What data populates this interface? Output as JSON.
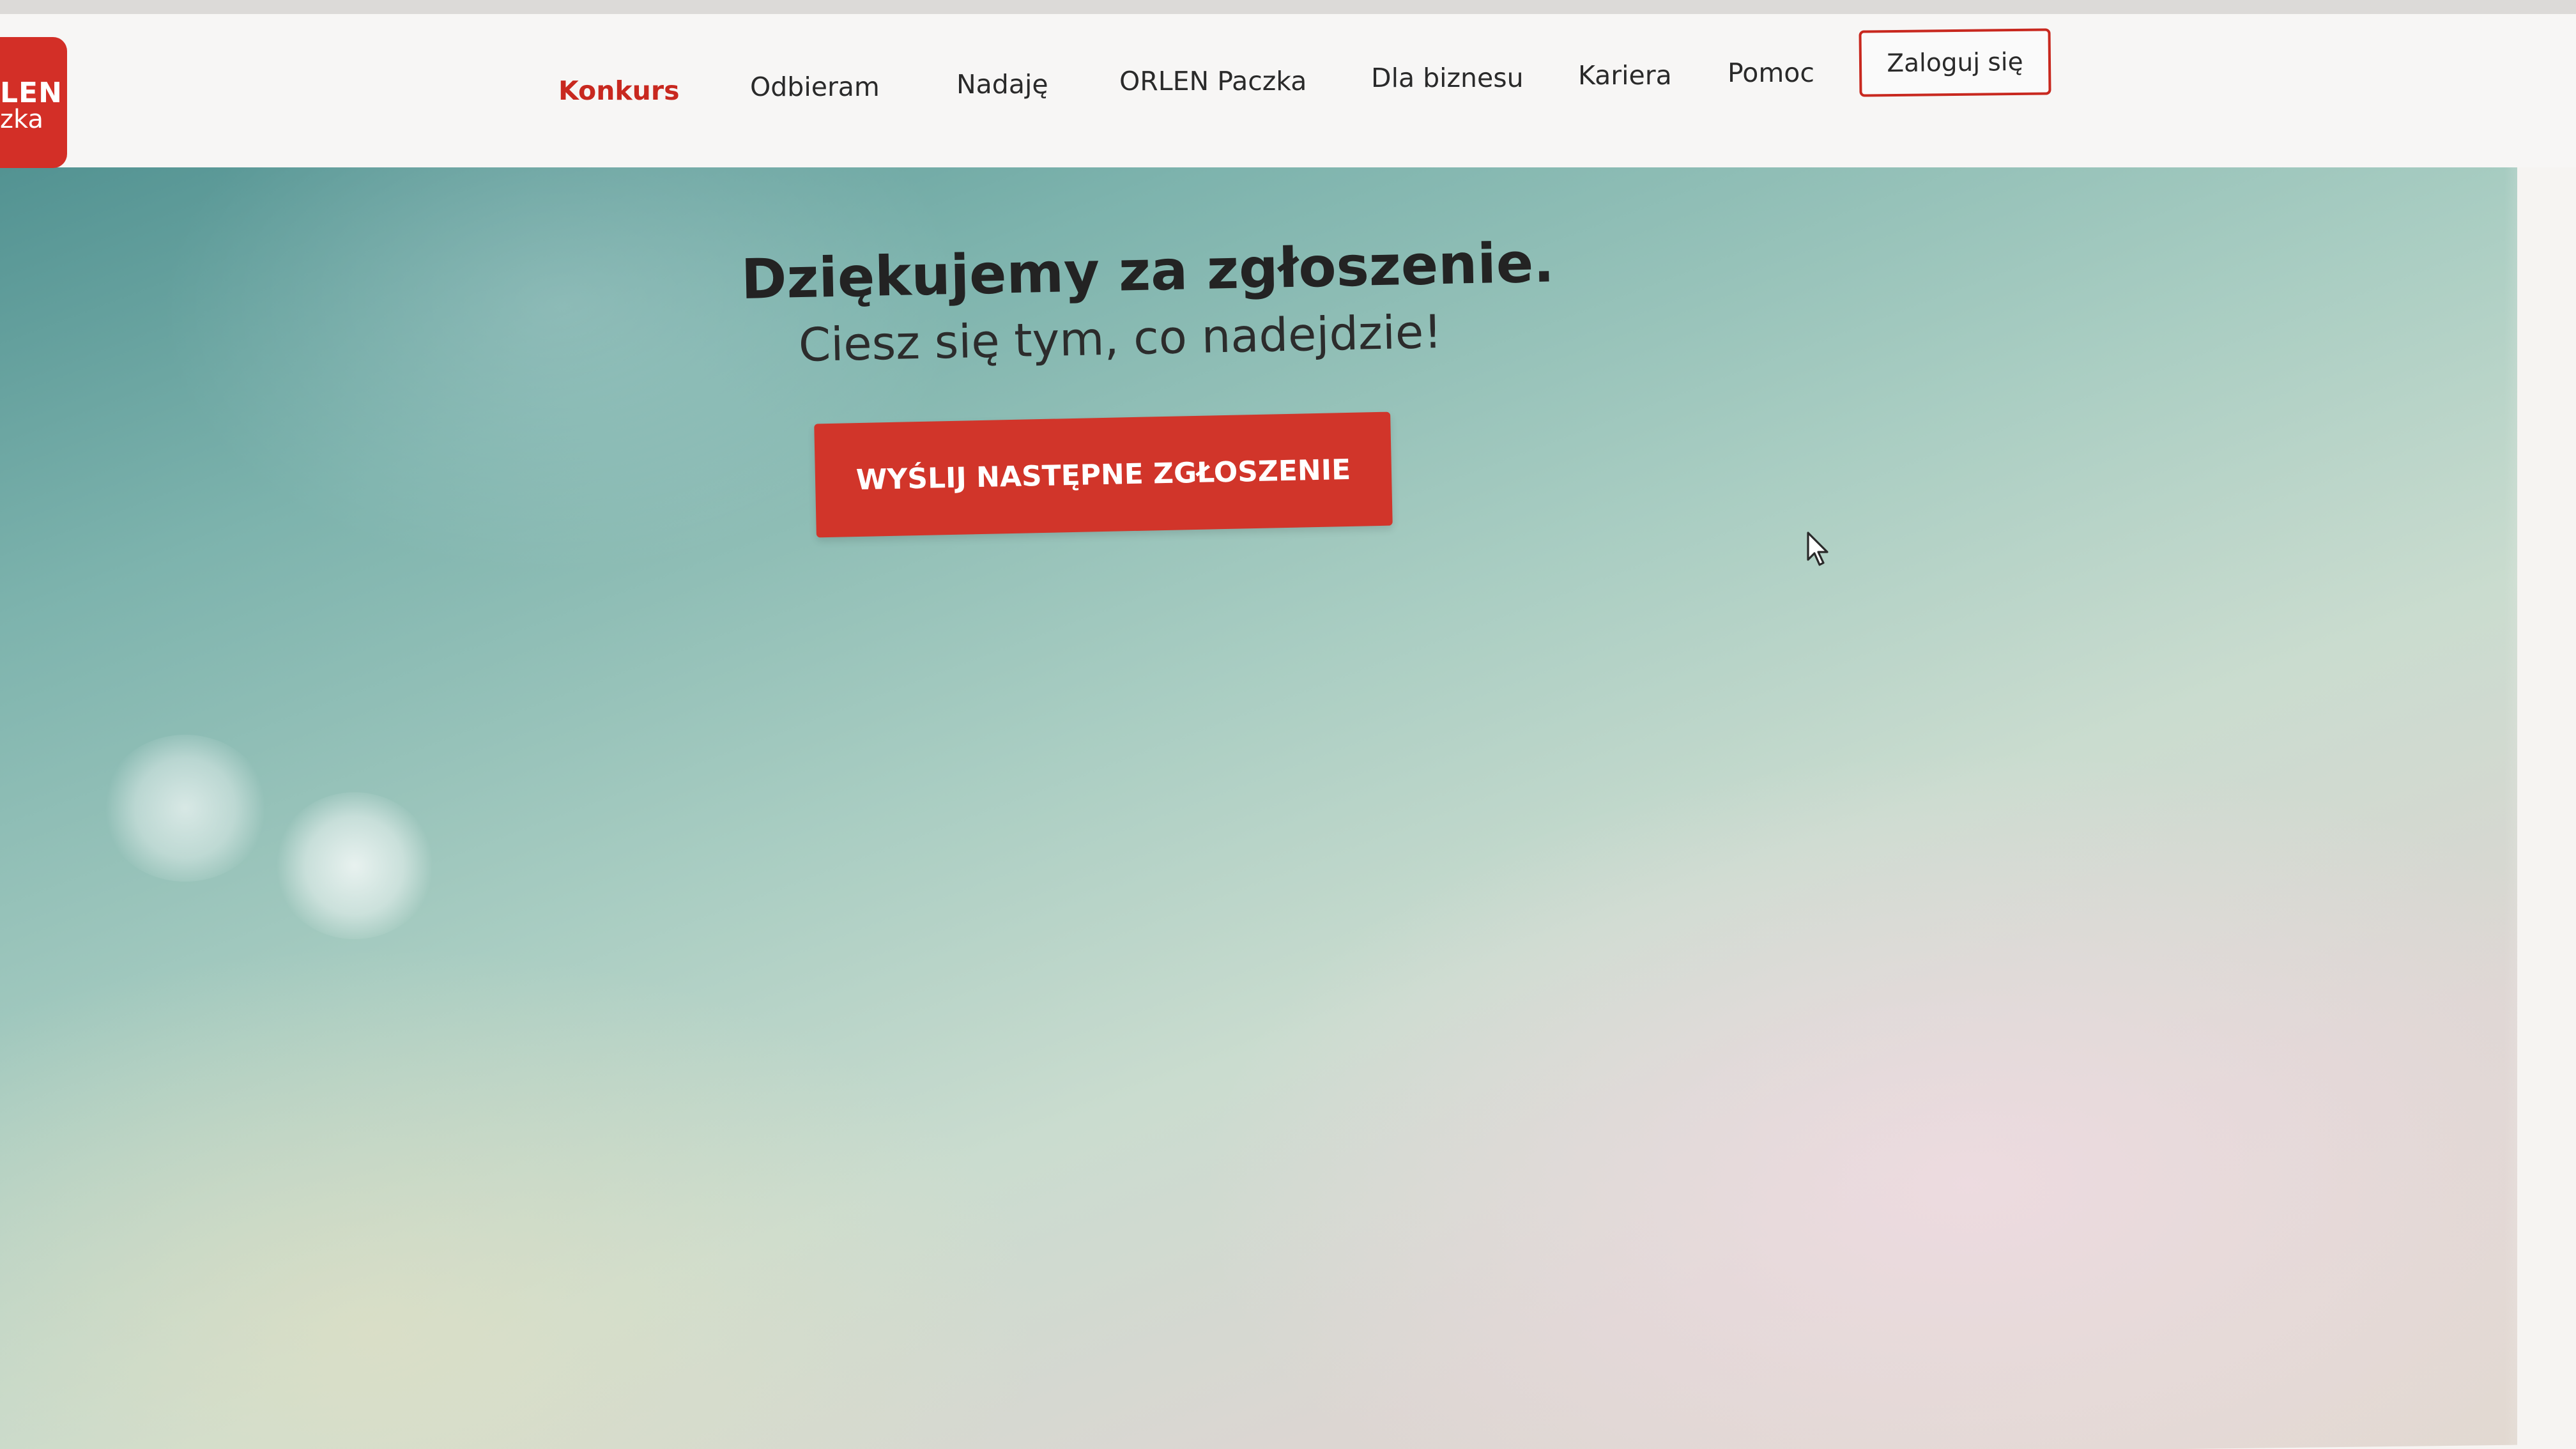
{
  "logo": {
    "line1": "LEN",
    "line2": "zka"
  },
  "nav": {
    "items": [
      {
        "label": "Konkurs",
        "active": true
      },
      {
        "label": "Odbieram",
        "active": false
      },
      {
        "label": "Nadaję",
        "active": false
      },
      {
        "label": "ORLEN Paczka",
        "active": false
      },
      {
        "label": "Dla biznesu",
        "active": false
      },
      {
        "label": "Kariera",
        "active": false
      },
      {
        "label": "Pomoc",
        "active": false
      }
    ],
    "login_label": "Zaloguj się"
  },
  "main": {
    "title": "Dziękujemy za zgłoszenie.",
    "subtitle": "Ciesz się tym, co nadejdzie!",
    "cta_label": "WYŚLIJ NASTĘPNE ZGŁOSZENIE"
  },
  "colors": {
    "brand_red": "#d1352a",
    "active_nav": "#c8281f",
    "text_dark": "#232323"
  },
  "icons": {
    "cursor": "mouse-pointer-icon"
  }
}
